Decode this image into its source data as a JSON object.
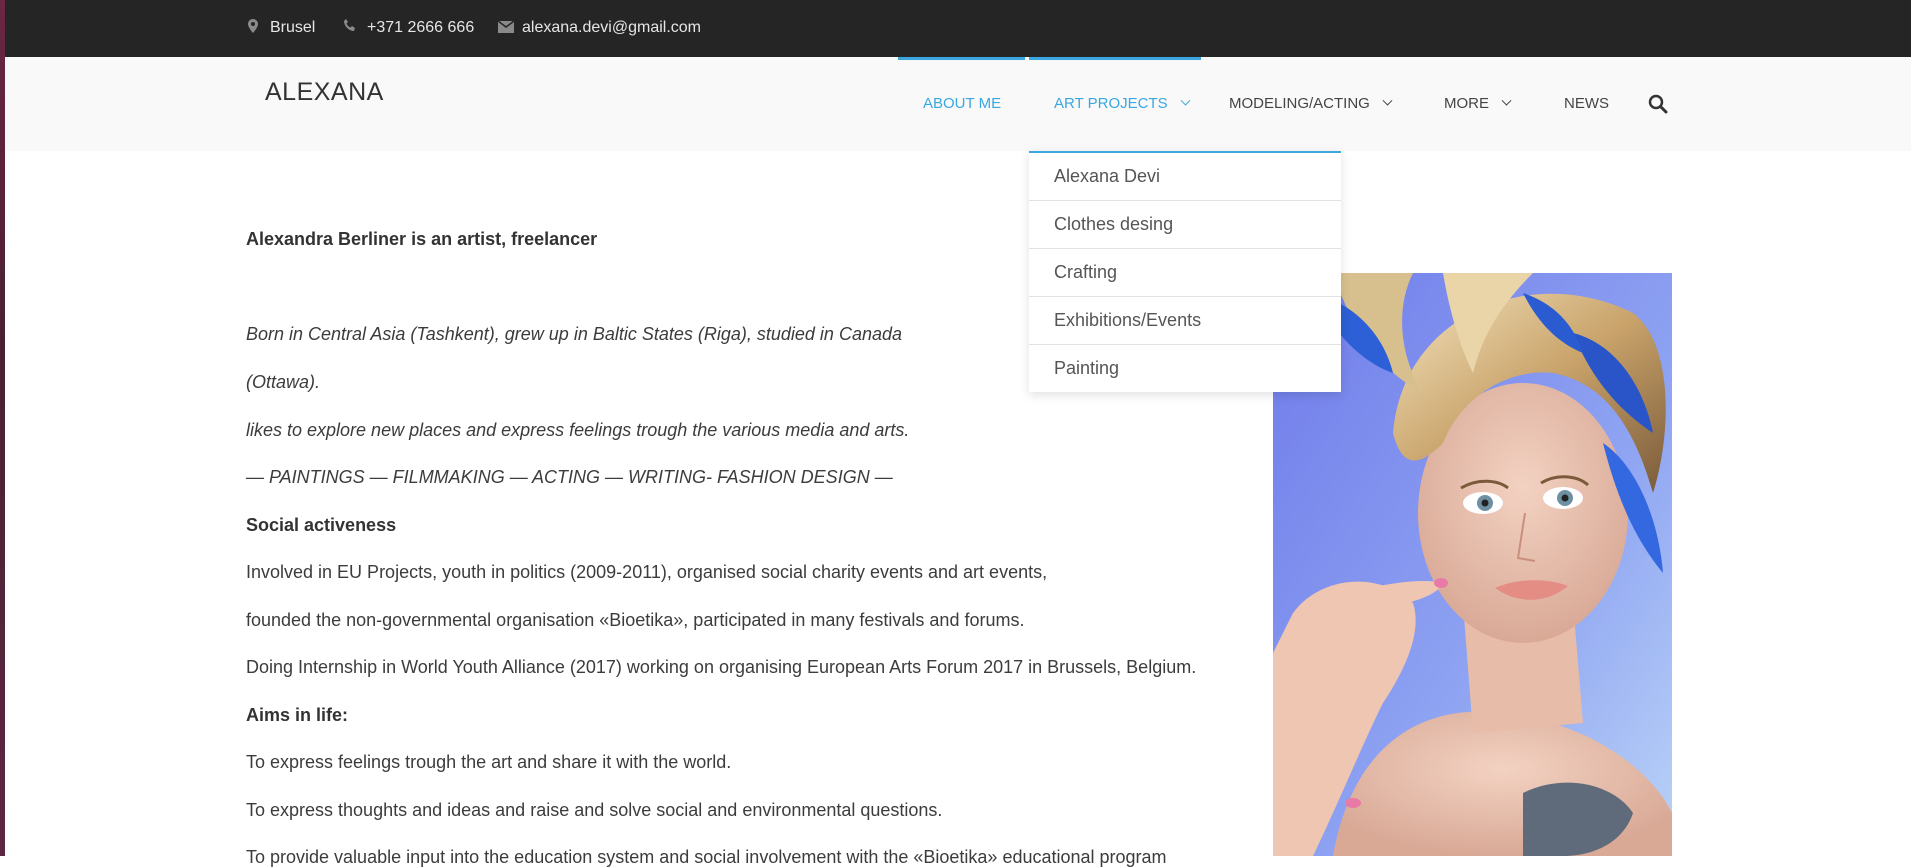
{
  "topbar": {
    "location": "Brusel",
    "phone": "+371 2666 666",
    "email": "alexana.devi@gmail.com"
  },
  "header": {
    "brand": "ALEXANA",
    "nav": [
      {
        "label": "ABOUT ME"
      },
      {
        "label": "ART PROJECTS"
      },
      {
        "label": "MODELING/ACTING"
      },
      {
        "label": "MORE"
      },
      {
        "label": "NEWS"
      }
    ]
  },
  "dropdown": {
    "items": [
      "Alexana Devi",
      "Clothes desing",
      "Crafting",
      "Exhibitions/Events",
      "Painting"
    ]
  },
  "content": {
    "intro": "Alexandra Berliner is an artist, freelancer",
    "born_1": "Born in Central Asia (Tashkent), grew up in Baltic States (Riga), studied in Canada",
    "born_2": "(Ottawa).",
    "explore": " likes to explore new places and express feelings trough the various media and arts.",
    "skills": " — PAINTINGS — FILMMAKING — ACTING — WRITING- FASHION DESIGN —",
    "social_heading": "Social activeness",
    "social_1": "Involved in EU Projects, youth in politics (2009-2011), organised social charity events and art events,",
    "social_2": "founded the non-governmental organisation «Bioetika», participated in many festivals and forums.",
    "social_3": "Doing Internship in World Youth Alliance (2017) working on organising European Arts Forum 2017 in Brussels, Belgium.",
    "aims_heading": "Aims in life:",
    "aim_1": "To express feelings trough the art and share it with the world.",
    "aim_2": "To express thoughts and ideas and raise and solve social and environmental questions.",
    "aim_3": "To provide valuable input into the education system and social involvement with the «Bioetika» educational program"
  },
  "colors": {
    "accent": "#3aa7e0",
    "topbar_bg": "#252525",
    "header_bg": "#f9f9f9"
  },
  "icons": [
    "map-marker-icon",
    "phone-icon",
    "envelope-icon",
    "search-icon",
    "chevron-down-icon"
  ]
}
